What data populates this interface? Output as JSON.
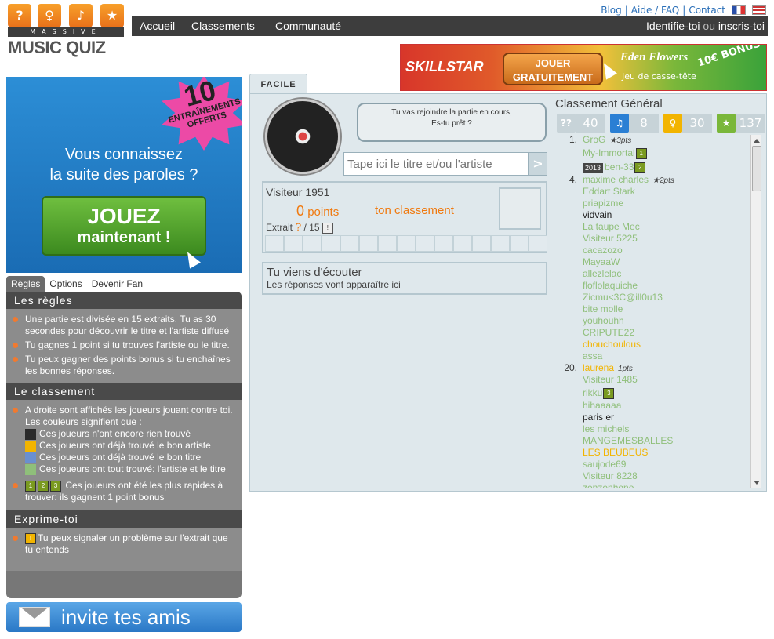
{
  "header": {
    "links": [
      "Blog",
      "Aide / FAQ",
      "Contact"
    ],
    "nav": [
      "Accueil",
      "Classements",
      "Communauté"
    ],
    "login": "Identifie-toi",
    "or": "ou",
    "register": "inscris-toi",
    "logo_strip": "MASSIVE",
    "logo_text": "MUSIC QUIZ"
  },
  "banner": {
    "brand": "SKILLSTAR",
    "cta_line1": "JOUER",
    "cta_line2": "GRATUITEMENT",
    "game_name": "Eden Flowers",
    "game_sub": "Jeu de casse-tête",
    "bonus": "10€ BONUS"
  },
  "promo": {
    "badge_number": "10",
    "badge_text": "ENTRAÎNEMENTS OFFERTS",
    "question_line1": "Vous connaissez",
    "question_line2": "la suite des paroles ?",
    "button_line1": "JOUEZ",
    "button_line2": "maintenant !"
  },
  "left_tabs": [
    "Règles",
    "Options",
    "Devenir Fan"
  ],
  "rules": {
    "rules_title": "Les règles",
    "rules_items": [
      "Une partie est divisée en 15 extraits. Tu as 30 secondes pour découvrir le titre et l'artiste diffusé",
      "Tu gagnes 1 point si tu trouves l'artiste ou le titre.",
      "Tu peux gagner des points bonus si tu enchaînes les bonnes réponses."
    ],
    "ranking_title": "Le classement",
    "ranking_intro": "A droite sont affichés les joueurs jouant contre toi. Les couleurs signifient que :",
    "legend": [
      {
        "color": "#2a2a2a",
        "text": "Ces joueurs n'ont encore rien trouvé"
      },
      {
        "color": "#f2b400",
        "text": "Ces joueurs ont déjà trouvé le bon artiste"
      },
      {
        "color": "#6a8fd0",
        "text": "Ces joueurs ont déjà trouvé le bon titre"
      },
      {
        "color": "#8fbf7a",
        "text": "Ces joueurs ont tout trouvé: l'artiste et le titre"
      }
    ],
    "fast_text": "Ces joueurs ont été les plus rapides à trouver: ils gagnent 1 point bonus",
    "express_title": "Exprime-toi",
    "express_text": "Tu peux signaler un problème sur l'extrait que tu entends"
  },
  "invite_label": "invite tes amis",
  "game": {
    "level_tab": "FACILE",
    "bubble_line1": "Tu vas rejoindre la partie en cours,",
    "bubble_line2": "Es-tu prêt ?",
    "answer_placeholder": "Tape ici le titre et/ou l'artiste",
    "go_label": ">",
    "player": "Visiteur 1951",
    "points_value": "0",
    "points_label": "points",
    "rank_label": "ton classement",
    "extract_label": "Extrait",
    "extract_current": "?",
    "extract_total": "/ 15",
    "listen_title": "Tu viens d'écouter",
    "listen_sub": "Les réponses vont apparaître ici"
  },
  "leaderboard": {
    "title": "Classement Général",
    "stats": [
      {
        "icon": "question-icon",
        "value": "40",
        "color": "#c7d3d8"
      },
      {
        "icon": "music-note-icon",
        "value": "8",
        "color": "#2a7fd4"
      },
      {
        "icon": "microphone-icon",
        "value": "30",
        "color": "#f2b400"
      },
      {
        "icon": "star-icon",
        "value": "137",
        "color": "#7ab73a"
      }
    ],
    "players": [
      {
        "rank": "1.",
        "name": "GroG",
        "pts": "★3pts",
        "color": "#8fbf7a"
      },
      {
        "rank": "",
        "name": "My-Immortal",
        "medal": "1",
        "color": "#8fbf7a"
      },
      {
        "rank": "",
        "name": "ben-33",
        "medal": "2",
        "year": "2013",
        "color": "#8fbf7a"
      },
      {
        "rank": "4.",
        "name": "maxime charles",
        "pts": "★2pts",
        "color": "#8fbf7a"
      },
      {
        "rank": "",
        "name": "Eddart Stark",
        "color": "#8fbf7a"
      },
      {
        "rank": "",
        "name": "priapizme",
        "color": "#8fbf7a"
      },
      {
        "rank": "",
        "name": "vidvain",
        "color": "#222"
      },
      {
        "rank": "",
        "name": "La taupe Mec",
        "color": "#8fbf7a"
      },
      {
        "rank": "",
        "name": "Visiteur 5225",
        "color": "#8fbf7a"
      },
      {
        "rank": "",
        "name": "cacazozo",
        "color": "#8fbf7a"
      },
      {
        "rank": "",
        "name": "MayaaW",
        "color": "#8fbf7a"
      },
      {
        "rank": "",
        "name": "allezlelac",
        "color": "#8fbf7a"
      },
      {
        "rank": "",
        "name": "floflolaquiche",
        "color": "#8fbf7a"
      },
      {
        "rank": "",
        "name": "Zicmu<3C@ill0u13",
        "color": "#8fbf7a"
      },
      {
        "rank": "",
        "name": "bite molle",
        "color": "#8fbf7a"
      },
      {
        "rank": "",
        "name": "youhouhh",
        "color": "#8fbf7a"
      },
      {
        "rank": "",
        "name": "CRIPUTE22",
        "color": "#8fbf7a"
      },
      {
        "rank": "",
        "name": "chouchoulous",
        "color": "#f2b400"
      },
      {
        "rank": "",
        "name": "assa",
        "color": "#8fbf7a"
      },
      {
        "rank": "20.",
        "name": "laurena",
        "pts": "1pts",
        "color": "#f2b400"
      },
      {
        "rank": "",
        "name": "Visiteur 1485",
        "color": "#8fbf7a"
      },
      {
        "rank": "",
        "name": "rikku",
        "medal": "3",
        "color": "#8fbf7a"
      },
      {
        "rank": "",
        "name": "hihaaaaa",
        "color": "#8fbf7a"
      },
      {
        "rank": "",
        "name": "paris er",
        "color": "#222"
      },
      {
        "rank": "",
        "name": "les michels",
        "color": "#8fbf7a"
      },
      {
        "rank": "",
        "name": "MANGEMESBALLES",
        "color": "#8fbf7a"
      },
      {
        "rank": "",
        "name": "LES BEUBEUS",
        "color": "#f2b400"
      },
      {
        "rank": "",
        "name": "saujode69",
        "color": "#8fbf7a"
      },
      {
        "rank": "",
        "name": "Visiteur 8228",
        "color": "#8fbf7a"
      },
      {
        "rank": "",
        "name": "zenzenhone",
        "color": "#8fbf7a"
      }
    ]
  }
}
